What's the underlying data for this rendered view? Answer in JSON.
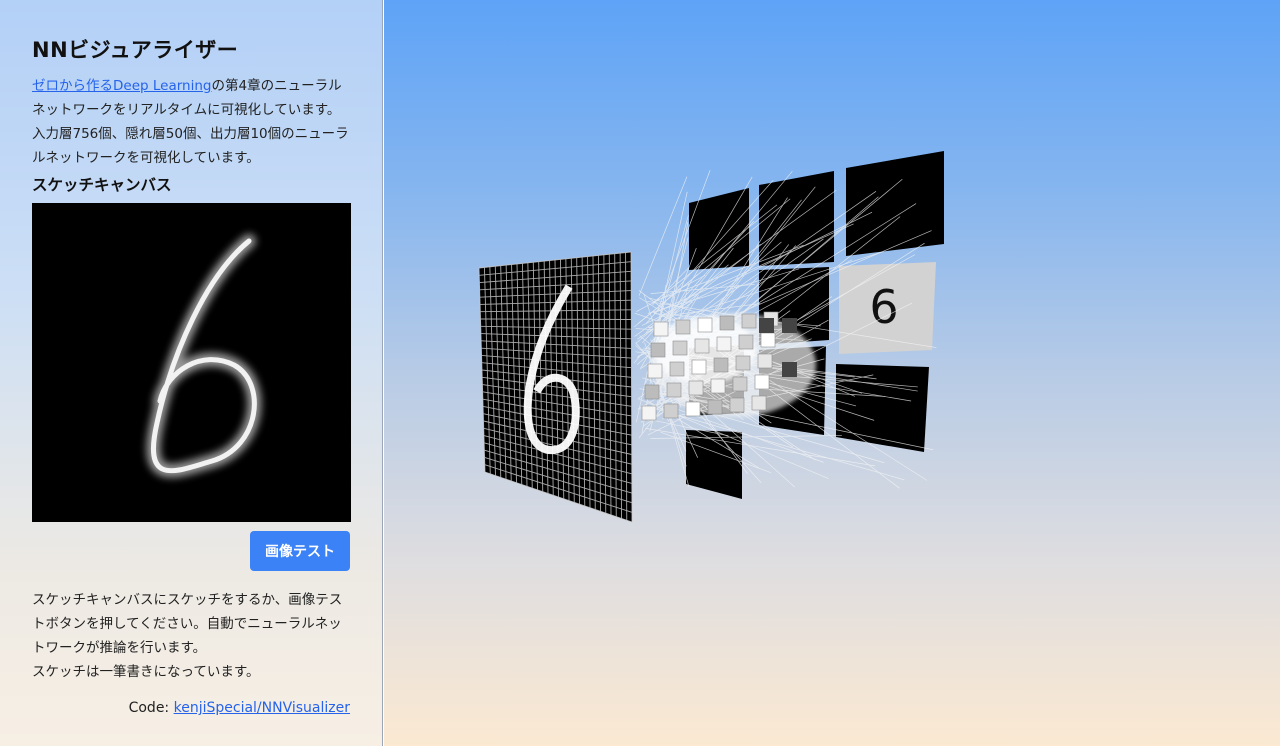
{
  "sidebar": {
    "title": "NNビジュアライザー",
    "intro_link": "ゼロから作るDeep Learning",
    "intro_rest": "の第4章のニューラルネットワークをリアルタイムに可視化しています。",
    "intro_line2": "入力層756個、隠れ層50個、出力層10個のニューラルネットワークを可視化しています。",
    "sketch_heading": "スケッチキャンバス",
    "test_button": "画像テスト",
    "instructions_1": "スケッチキャンバスにスケッチをするか、画像テストボタンを押してください。自動でニューラルネットワークが推論を行います。",
    "instructions_2": "スケッチは一筆書きになっています。",
    "code_label": "Code: ",
    "code_link": "kenjiSpecial/NNVisualizer"
  },
  "visualizer": {
    "input_digit": "6",
    "output_digit": "6",
    "input_neurons": 756,
    "hidden_neurons": 50,
    "output_neurons": 10
  },
  "colors": {
    "link": "#2563eb",
    "button": "#3b82f6",
    "sky_top": "#5ea3f7",
    "sky_bottom": "#fbe9d2"
  }
}
